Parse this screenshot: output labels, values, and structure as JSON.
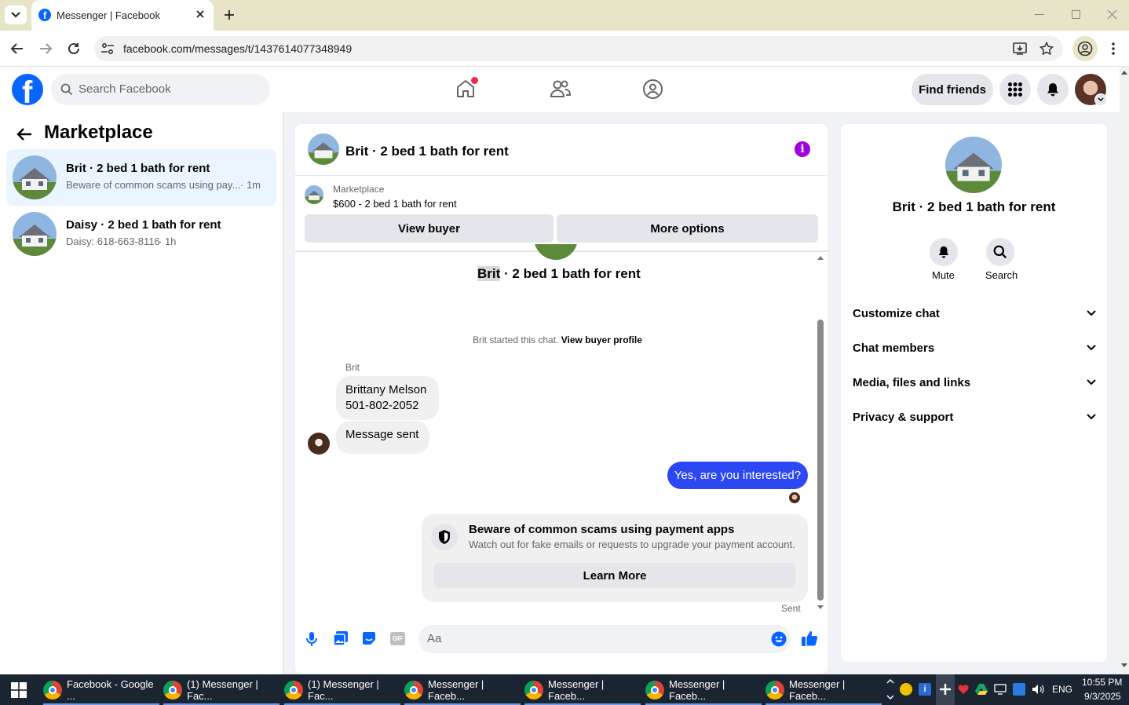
{
  "browser": {
    "tab_title": "Messenger | Facebook",
    "url": "facebook.com/messages/t/1437614077348949"
  },
  "header": {
    "search_placeholder": "Search Facebook",
    "find_friends": "Find friends"
  },
  "sidebar": {
    "title": "Marketplace",
    "conversations": [
      {
        "title": "Brit · 2 bed 1 bath for rent",
        "preview": "Beware of common scams using pay...",
        "time": "· 1m"
      },
      {
        "title": "Daisy · 2 bed 1 bath for rent",
        "preview": "Daisy: 618-663-8116",
        "time": "· 1h"
      }
    ]
  },
  "chat": {
    "title": "Brit · 2 bed 1 bath for rent",
    "listing_source": "Marketplace",
    "listing_desc": "$600 - 2 bed 1 bath for rent",
    "view_buyer": "View buyer",
    "more_options": "More options",
    "thread_name_highlight": "Brit",
    "thread_name_rest": " · 2 bed 1 bath for rent",
    "started_text": "Brit started this chat.",
    "view_profile": "View buyer profile",
    "sender": "Brit",
    "msg1_line1": "Brittany Melson",
    "msg1_line2": "501-802-2052",
    "msg2": "Message sent",
    "my_msg": "Yes, are you interested?",
    "scam_title": "Beware of common scams using payment apps",
    "scam_body": "Watch out for fake emails or requests to upgrade your payment account.",
    "learn_more": "Learn More",
    "status": "Sent",
    "composer_placeholder": "Aa"
  },
  "info": {
    "name": "Brit · 2 bed 1 bath for rent",
    "mute": "Mute",
    "search": "Search",
    "sections": [
      "Customize chat",
      "Chat members",
      "Media, files and links",
      "Privacy & support"
    ]
  },
  "taskbar": {
    "tasks": [
      "Facebook - Google ...",
      "(1) Messenger | Fac...",
      "(1) Messenger | Fac...",
      "Messenger | Faceb...",
      "Messenger | Faceb...",
      "Messenger | Faceb...",
      "Messenger | Faceb..."
    ],
    "lang": "ENG",
    "time": "10:55 PM",
    "date": "9/3/2025"
  },
  "colors": {
    "fb_blue": "#0866ff",
    "messenger_blue": "#2b48f2",
    "info_purple": "#a100e0"
  }
}
